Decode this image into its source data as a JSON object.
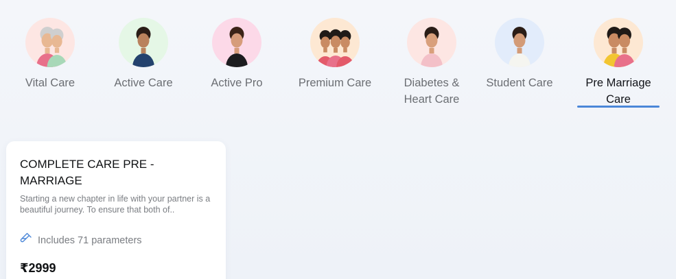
{
  "tabs": [
    {
      "label": "Vital Care",
      "bg": "#fde6e3",
      "skin": "#e8b893",
      "shirt": "#a8d8b8",
      "hair": "#cfcfcf"
    },
    {
      "label": "Active Care",
      "bg": "#e5f7e6",
      "skin": "#b9825d",
      "shirt": "#24426e",
      "hair": "#2a1d17"
    },
    {
      "label": "Active Pro",
      "bg": "#fcd9e8",
      "skin": "#d69c7a",
      "shirt": "#1c1c1f",
      "hair": "#3b2418"
    },
    {
      "label": "Premium Care",
      "bg": "#fde8d3",
      "skin": "#c98b63",
      "shirt": "#e35a6a",
      "hair": "#1f1a17"
    },
    {
      "label": "Diabetes & Heart Care",
      "bg": "#fde6e3",
      "skin": "#d9a07c",
      "shirt": "#f3c0c8",
      "hair": "#2a1d17"
    },
    {
      "label": "Student Care",
      "bg": "#e2ecfb",
      "skin": "#d39b77",
      "shirt": "#f5f5f0",
      "hair": "#2a1d17"
    },
    {
      "label": "Pre Marriage Care",
      "bg": "#fde8d3",
      "skin": "#c98b63",
      "shirt": "#f2c531",
      "hair": "#1f1a17"
    }
  ],
  "active_tab_index": 6,
  "card": {
    "title": "COMPLETE CARE PRE - MARRIAGE",
    "description": "Starting a new chapter in life with your partner is a beautiful journey. To ensure that both of..",
    "parameters_text": "Includes 71 parameters",
    "parameters_icon": "test-tube-icon",
    "price": "₹2999"
  },
  "colors": {
    "accent": "#4a86d8",
    "active_text": "#111318",
    "inactive_text": "#6b6e73"
  }
}
